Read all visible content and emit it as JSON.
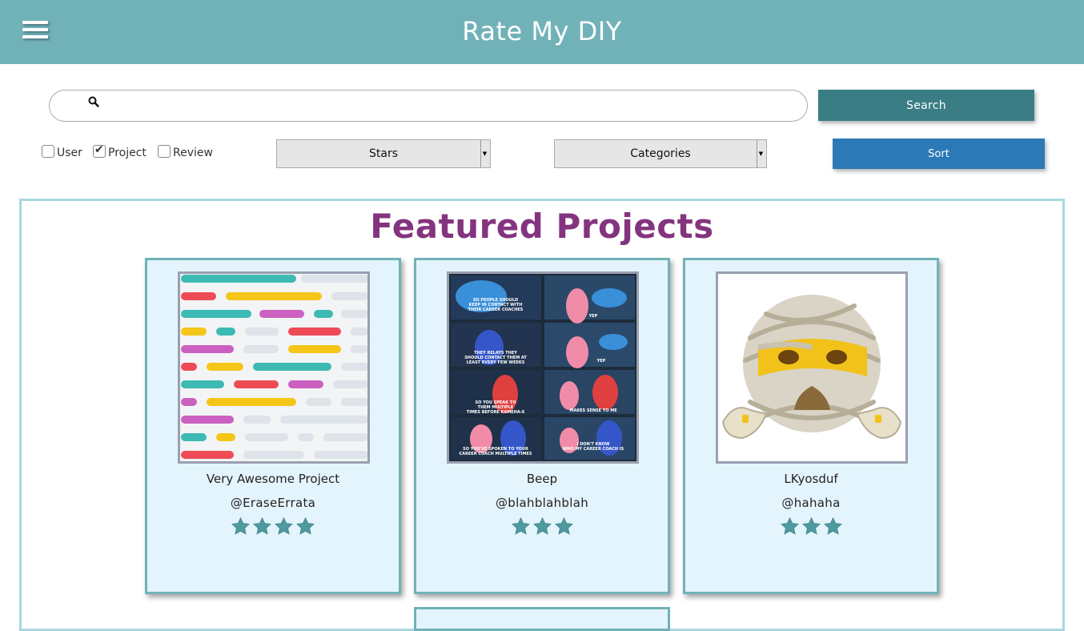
{
  "header": {
    "title": "Rate My DIY",
    "menu_icon": "hamburger-icon",
    "bg_color": "#71b2b8"
  },
  "search": {
    "placeholder": "",
    "value": "",
    "button_label": "Search",
    "icon": "search-icon"
  },
  "filters": [
    {
      "label": "User",
      "checked": false
    },
    {
      "label": "Project",
      "checked": true
    },
    {
      "label": "Review",
      "checked": false
    }
  ],
  "dropdowns": {
    "stars": "Stars",
    "categories": "Categories"
  },
  "sort_label": "Sort",
  "featured": {
    "title": "Featured Projects",
    "title_color": "#84347e",
    "cards": [
      {
        "name": "Very Awesome Project",
        "user": "@EraseErrata",
        "rating": 4,
        "image": "code-lines-thumbnail"
      },
      {
        "name": "Beep",
        "user": "@blahblahblah",
        "rating": 3,
        "image": "meme-comic-thumbnail"
      },
      {
        "name": "LKyosduf",
        "user": "@hahaha",
        "rating": 3,
        "image": "mummy-emoji-thumbnail"
      }
    ]
  },
  "colors": {
    "star": "#4e9a9e",
    "card_bg": "#e4f4fc",
    "card_border": "#71b2b8",
    "sort_button": "#2b79b6",
    "search_button": "#3a7d85"
  }
}
